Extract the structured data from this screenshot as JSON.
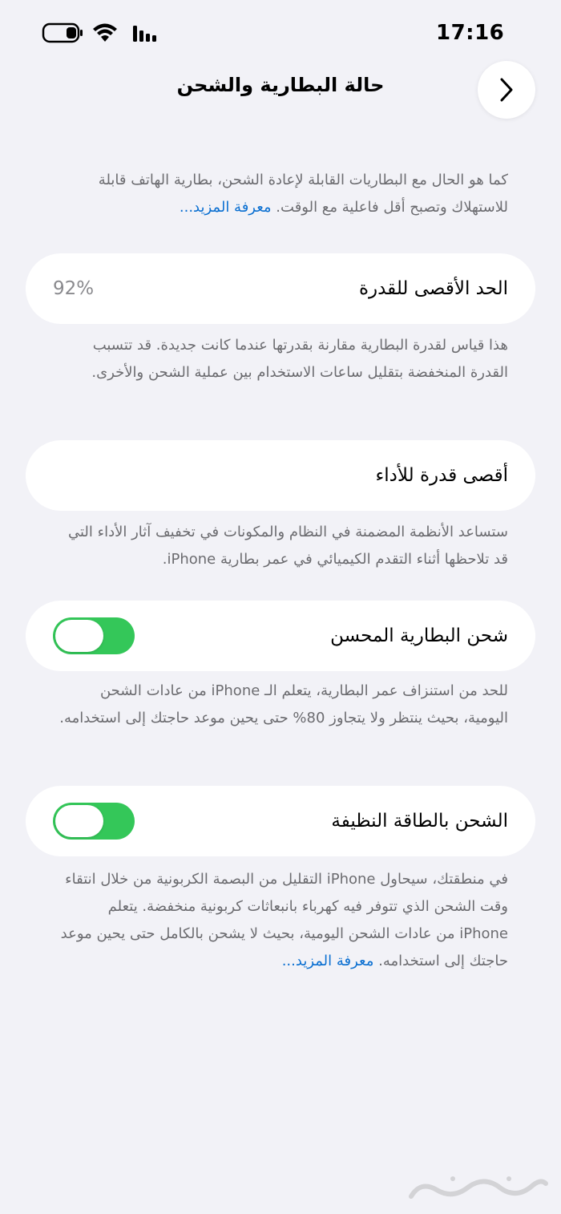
{
  "status_bar": {
    "time": "17:16",
    "battery_icon": "battery-icon",
    "wifi_icon": "wifi-icon",
    "signal_icon": "cellular-signal-icon"
  },
  "header": {
    "title": "حالة البطارية والشحن",
    "back_icon": "chevron-right-icon"
  },
  "intro": {
    "text": "كما هو الحال مع البطاريات القابلة لإعادة الشحن، بطارية الهاتف قابلة للاستهلاك وتصبح أقل فاعلية مع الوقت.",
    "link": "معرفة المزيد..."
  },
  "max_capacity": {
    "label": "الحد الأقصى للقدرة",
    "value": "92%",
    "description": "هذا قياس لقدرة البطارية مقارنة بقدرتها عندما كانت جديدة. قد تتسبب القدرة المنخفضة بتقليل ساعات الاستخدام بين عملية الشحن والأخرى."
  },
  "peak_performance": {
    "label": "أقصى قدرة للأداء",
    "description": "ستساعد الأنظمة المضمنة في النظام والمكونات في تخفيف آثار الأداء التي قد تلاحظها أثناء التقدم الكيميائي في عمر بطارية iPhone."
  },
  "optimized_charging": {
    "label": "شحن البطارية المحسن",
    "enabled": true,
    "description": "للحد من استنزاف عمر البطارية، يتعلم الـ iPhone من عادات الشحن اليومية، بحيث ينتظر ولا يتجاوز 80% حتى يحين موعد حاجتك إلى استخدامه."
  },
  "clean_energy": {
    "label": "الشحن بالطاقة النظيفة",
    "enabled": true,
    "description": "في منطقتك، سيحاول iPhone التقليل من البصمة الكربونية من خلال انتقاء وقت الشحن الذي تتوفر فيه كهرباء بانبعاثات كربونية منخفضة. يتعلم iPhone من عادات الشحن اليومية، بحيث لا يشحن بالكامل حتى يحين موعد حاجتك إلى استخدامه.",
    "link": "معرفة المزيد..."
  },
  "colors": {
    "background": "#f2f2f7",
    "toggle_on": "#34c759",
    "link": "#0a6fd1"
  },
  "watermark": {
    "text": "حراج"
  }
}
